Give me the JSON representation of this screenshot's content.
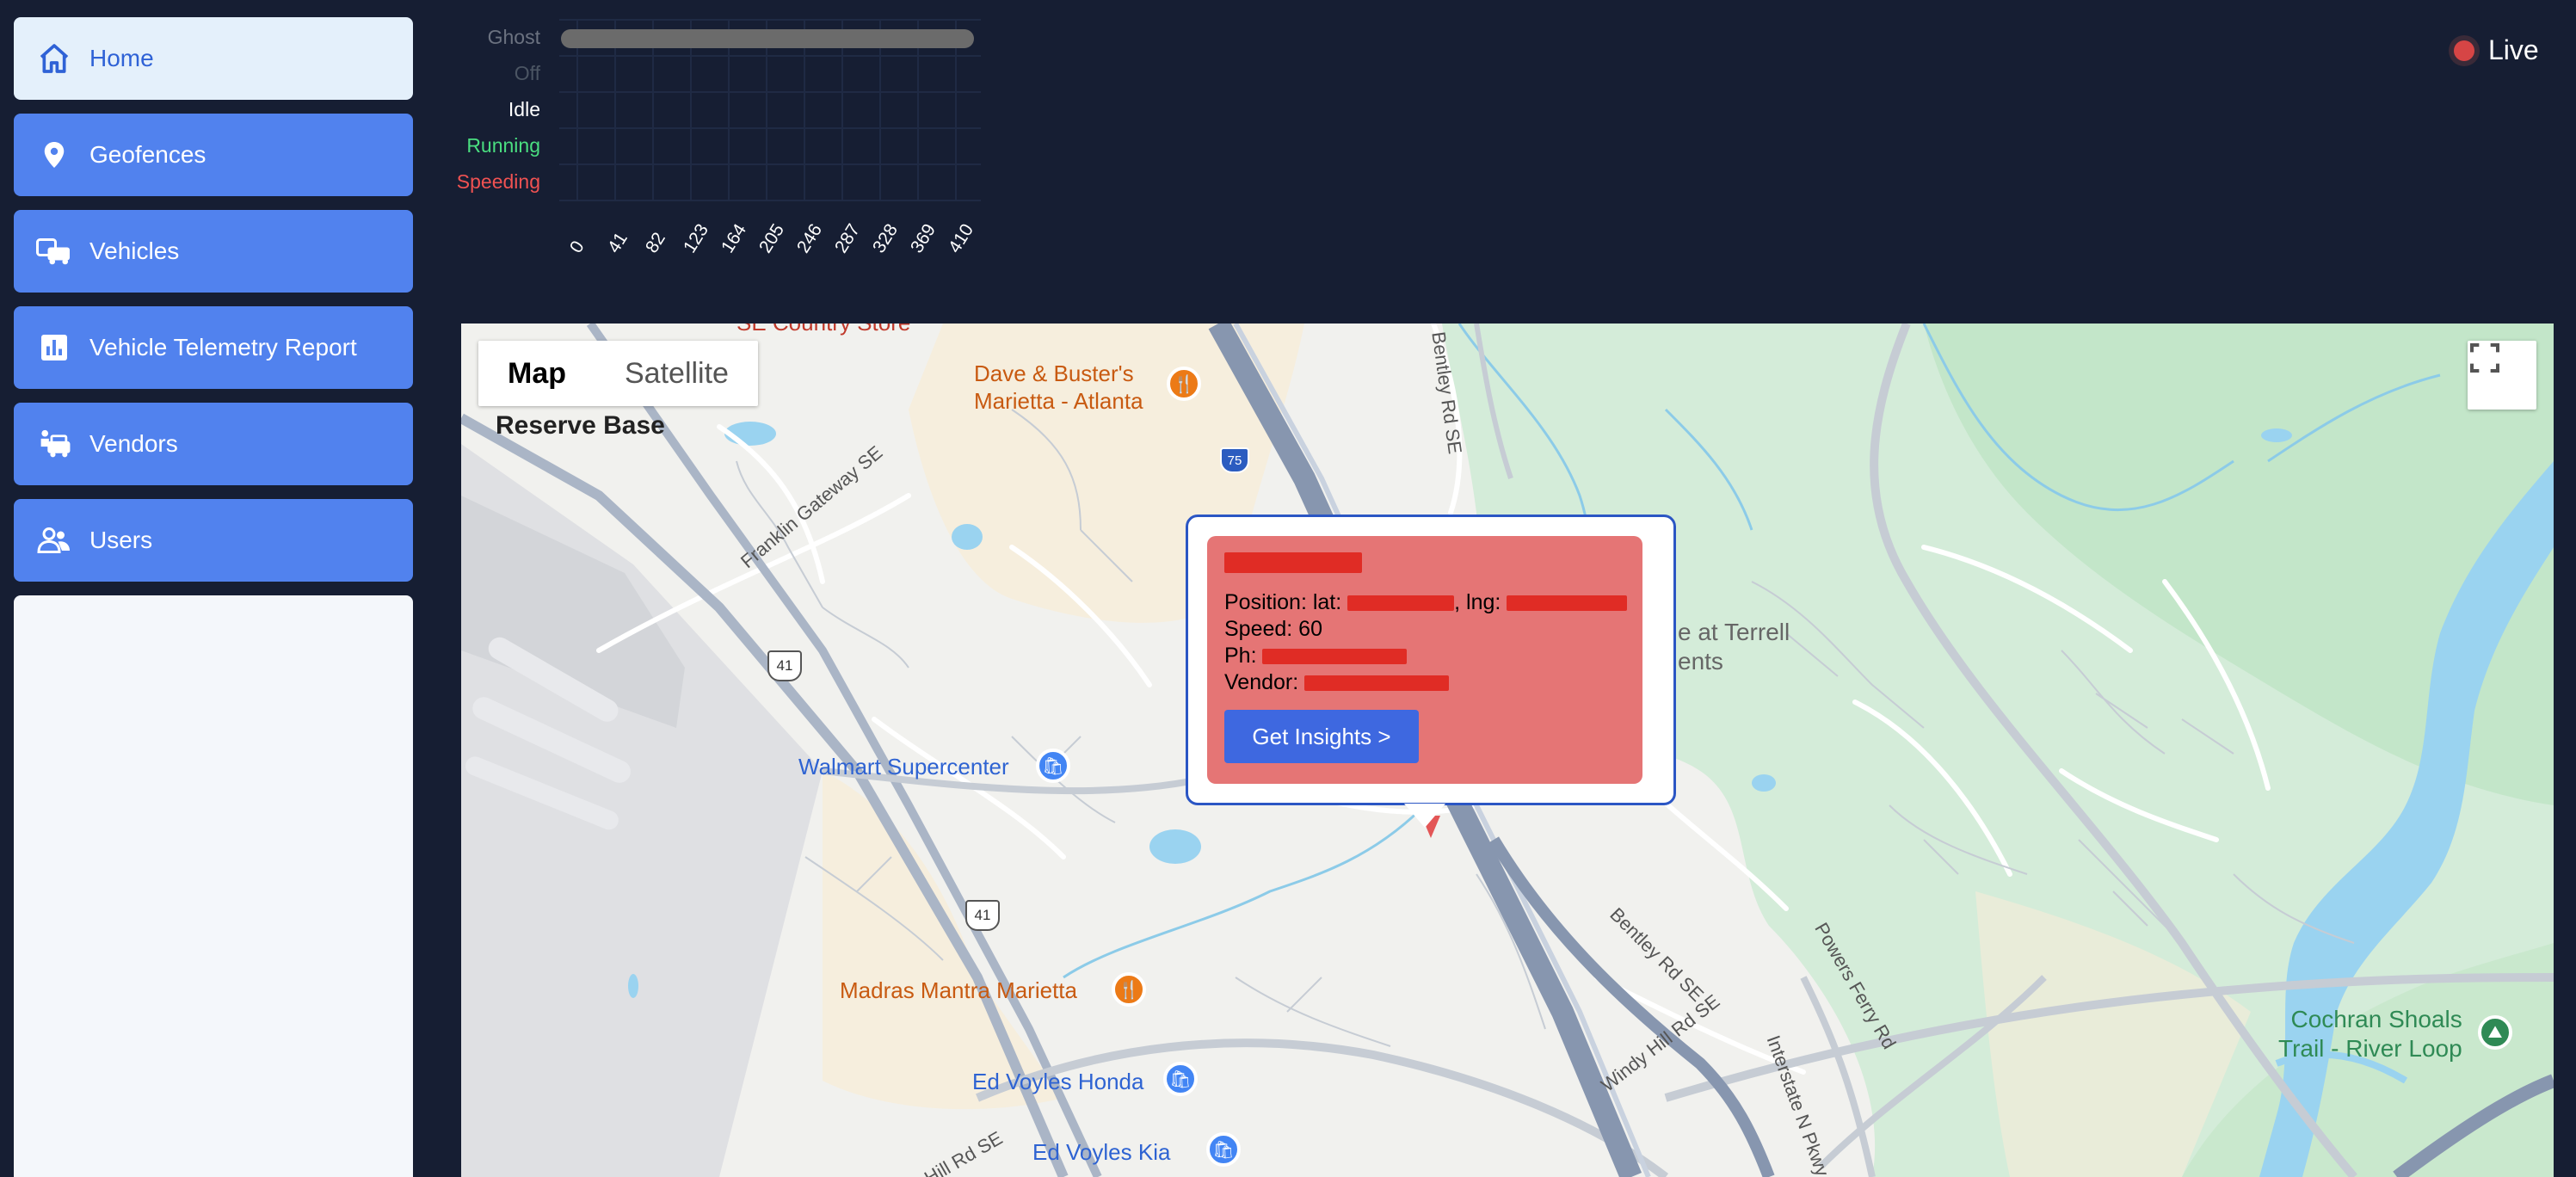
{
  "sidebar": {
    "items": [
      {
        "label": "Home",
        "icon": "home-icon",
        "active": true
      },
      {
        "label": "Geofences",
        "icon": "location-pin-icon",
        "active": false
      },
      {
        "label": "Vehicles",
        "icon": "vehicles-icon",
        "active": false
      },
      {
        "label": "Vehicle Telemetry Report",
        "icon": "bar-chart-icon",
        "active": false
      },
      {
        "label": "Vendors",
        "icon": "vendors-icon",
        "active": false
      },
      {
        "label": "Users",
        "icon": "users-icon",
        "active": false
      }
    ]
  },
  "status_chart": {
    "categories": [
      {
        "label": "Ghost",
        "color": "#6b7280"
      },
      {
        "label": "Off",
        "color": "#4b5563"
      },
      {
        "label": "Idle",
        "color": "#ffffff"
      },
      {
        "label": "Running",
        "color": "#4ade80"
      },
      {
        "label": "Speeding",
        "color": "#f05252"
      }
    ],
    "ticks": [
      "0",
      "41",
      "82",
      "123",
      "164",
      "205",
      "246",
      "287",
      "328",
      "369",
      "410"
    ]
  },
  "chart_data": {
    "type": "bar",
    "orientation": "horizontal",
    "categories": [
      "Ghost",
      "Off",
      "Idle",
      "Running",
      "Speeding"
    ],
    "values": [
      410,
      0,
      0,
      0,
      0
    ],
    "xlim": [
      0,
      410
    ],
    "grid": true
  },
  "live": {
    "label": "Live"
  },
  "map": {
    "type_buttons": {
      "map": "Map",
      "satellite": "Satellite"
    },
    "labels": {
      "reserve_base": "Reserve Base",
      "dave_busters": "Dave & Buster's\nMarietta - Atlanta",
      "walmart": "Walmart Supercenter",
      "madras": "Madras Mantra Marietta",
      "ed_voyles_honda": "Ed Voyles Honda",
      "ed_voyles_kia": "Ed Voyles Kia",
      "franklin": "Franklin Gateway SE",
      "bentley_top": "Bentley Rd SE",
      "bentley_mid": "Bentley Rd SE",
      "windy_hill": "Windy Hill Rd SE",
      "powers_ferry": "Powers Ferry Rd",
      "interstate_north": "Interstate N Pkwy",
      "terrell": "e at Terrell\nents",
      "cochran": "Cochran Shoals\nTrail - River Loop",
      "hill_rd": "Hill Rd SE",
      "country_store": "SE Country Store",
      "us41_a": "41",
      "us41_b": "41",
      "i75": "75"
    }
  },
  "popup": {
    "position_label": "Position: lat:",
    "lng_label": ", lng:",
    "speed_label": "Speed: 60",
    "phone_label": "Ph:",
    "vendor_label": "Vendor:",
    "button_label": "Get Insights >"
  }
}
